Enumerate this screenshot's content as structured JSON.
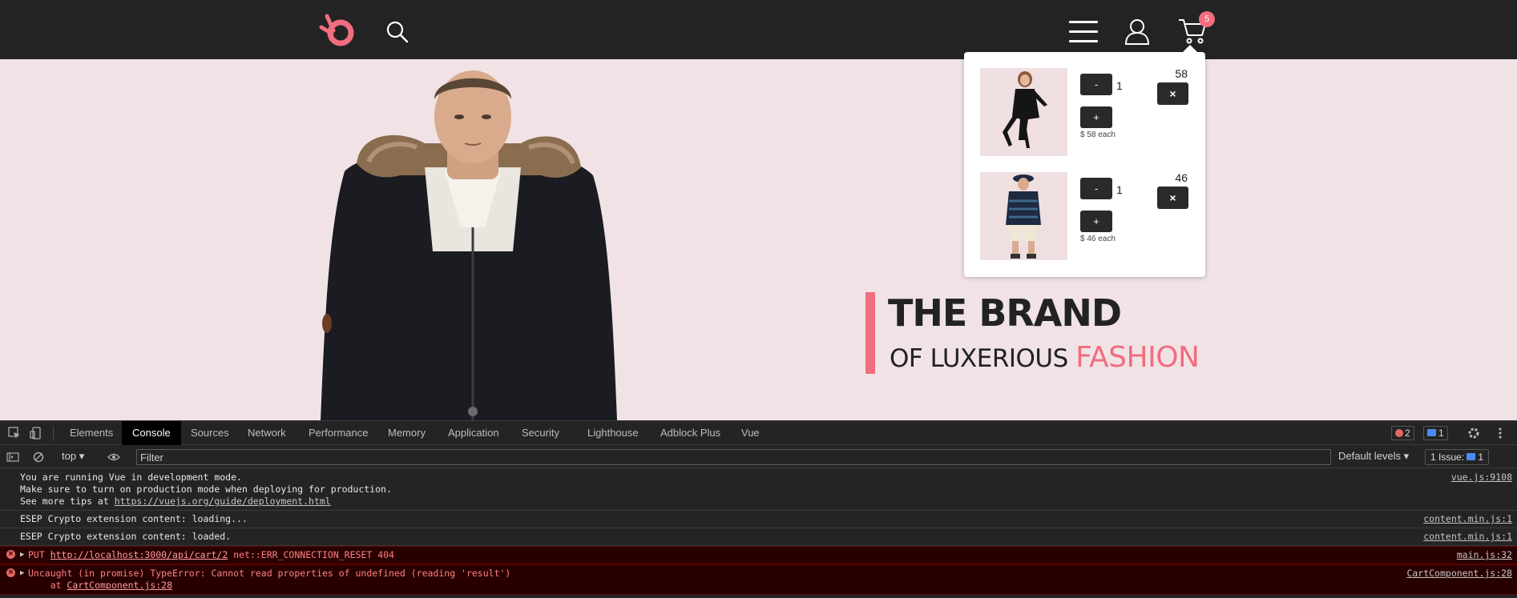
{
  "header": {
    "logo_icon": "brand-logo-icon",
    "search_icon": "search-icon",
    "menu_icon": "hamburger-menu-icon",
    "user_icon": "user-icon",
    "cart_icon": "shopping-cart-icon",
    "cart_count": "5"
  },
  "hero": {
    "title": "THE BRAND",
    "subtitle_prefix": "OF LUXERIOUS ",
    "subtitle_accent": "FASHION",
    "accent_color": "#f16d7f",
    "background_color": "#f1e3e5"
  },
  "cart": {
    "items": [
      {
        "minus_label": "-",
        "quantity": "1",
        "plus_label": "+",
        "each_text": "$ 58 each",
        "price": "58",
        "remove_label": "×"
      },
      {
        "minus_label": "-",
        "quantity": "1",
        "plus_label": "+",
        "each_text": "$ 46 each",
        "price": "46",
        "remove_label": "×"
      }
    ]
  },
  "devtools": {
    "tabs": [
      "Elements",
      "Console",
      "Sources",
      "Network",
      "Performance",
      "Memory",
      "Application",
      "Security",
      "Lighthouse",
      "Adblock Plus",
      "Vue"
    ],
    "active_tab": "Console",
    "error_count": "2",
    "message_count": "1",
    "context": "top",
    "filter_placeholder": "Filter",
    "levels": "Default levels",
    "issues_label": "1 Issue:",
    "issues_count": "1",
    "messages": [
      {
        "line1": "You are running Vue in development mode.",
        "line2": "Make sure to turn on production mode when deploying for production.",
        "line3_prefix": "See more tips at ",
        "line3_link": "https://vuejs.org/guide/deployment.html",
        "source": "vue.js:9108"
      },
      {
        "text": "ESEP Crypto extension content: loading...",
        "source": "content.min.js:1"
      },
      {
        "text": "ESEP Crypto extension content: loaded.",
        "source": "content.min.js:1"
      },
      {
        "prefix": "PUT ",
        "link": "http://localhost:3000/api/cart/2",
        "suffix": " net::ERR_CONNECTION_RESET 404",
        "source": "main.js:32"
      },
      {
        "line1": "Uncaught (in promise) TypeError: Cannot read properties of undefined (reading 'result')",
        "line2_prefix": "    at ",
        "line2_link": "CartComponent.js:28",
        "source": "CartComponent.js:28"
      }
    ]
  }
}
